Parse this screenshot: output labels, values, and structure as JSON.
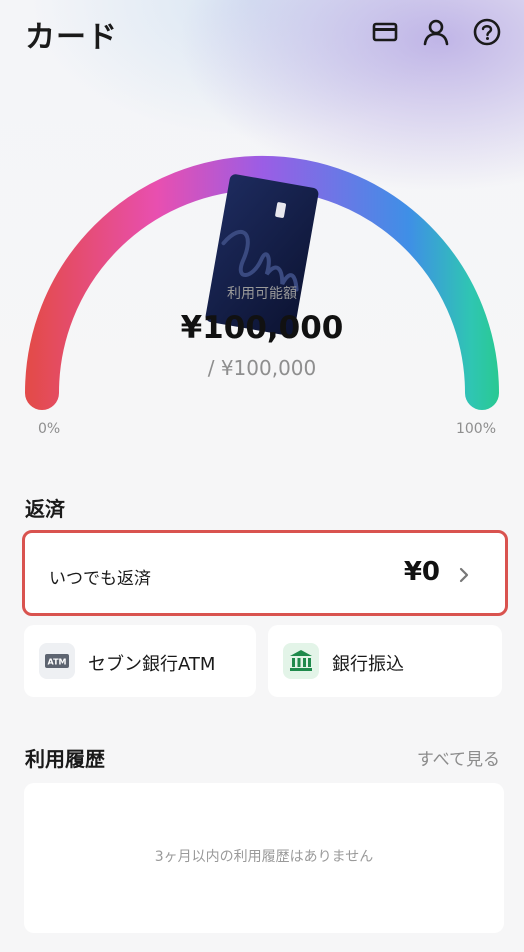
{
  "header": {
    "title": "カード",
    "icons": [
      "card-icon",
      "person-icon",
      "help-icon"
    ]
  },
  "gauge": {
    "available_label": "利用可能額",
    "available_amount": "¥100,000",
    "limit_amount": "/ ¥100,000",
    "min_label": "0%",
    "max_label": "100%",
    "fill_fraction": 1.0,
    "colors": [
      "#e34b4b",
      "#e84fb0",
      "#9b5de5",
      "#3f8fe6",
      "#2fc6b2",
      "#28c98d"
    ]
  },
  "repayment": {
    "section_title": "返済",
    "anytime_label": "いつでも返済",
    "anytime_amount": "¥0",
    "highlight_color": "#d9534f",
    "methods": [
      {
        "label": "セブン銀行ATM",
        "icon": "atm-icon",
        "icon_text": "ATM"
      },
      {
        "label": "銀行振込",
        "icon": "bank-icon"
      }
    ]
  },
  "history": {
    "section_title": "利用履歴",
    "see_all": "すべて見る",
    "empty_message": "3ヶ月以内の利用履歴はありません"
  }
}
